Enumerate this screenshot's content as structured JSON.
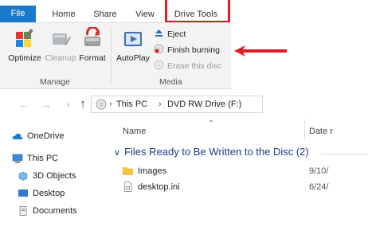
{
  "tabs": {
    "file": "File",
    "home": "Home",
    "share": "Share",
    "view": "View",
    "drive_tools": "Drive Tools"
  },
  "ribbon": {
    "manage": {
      "optimize": "Optimize",
      "cleanup": "Cleanup",
      "format": "Format",
      "group_label": "Manage"
    },
    "media": {
      "autoplay": "AutoPlay",
      "eject": "Eject",
      "finish_burning": "Finish burning",
      "erase_disc": "Erase this disc",
      "group_label": "Media"
    }
  },
  "navigation": {
    "address": {
      "crumbs": [
        "This PC",
        "DVD RW Drive (F:)"
      ]
    }
  },
  "sidebar": {
    "items": [
      "OneDrive",
      "This PC",
      "3D Objects",
      "Desktop",
      "Documents"
    ]
  },
  "content": {
    "columns": {
      "name": "Name",
      "date": "Date r"
    },
    "group_title": "Files Ready to Be Written to the Disc (2)",
    "files": [
      {
        "name": "Images",
        "date": "9/10/"
      },
      {
        "name": "desktop.ini",
        "date": "6/24/"
      }
    ]
  },
  "colors": {
    "file_tab": "#1979ca",
    "highlight": "#e01b24",
    "group_header": "#1e3a8a"
  }
}
